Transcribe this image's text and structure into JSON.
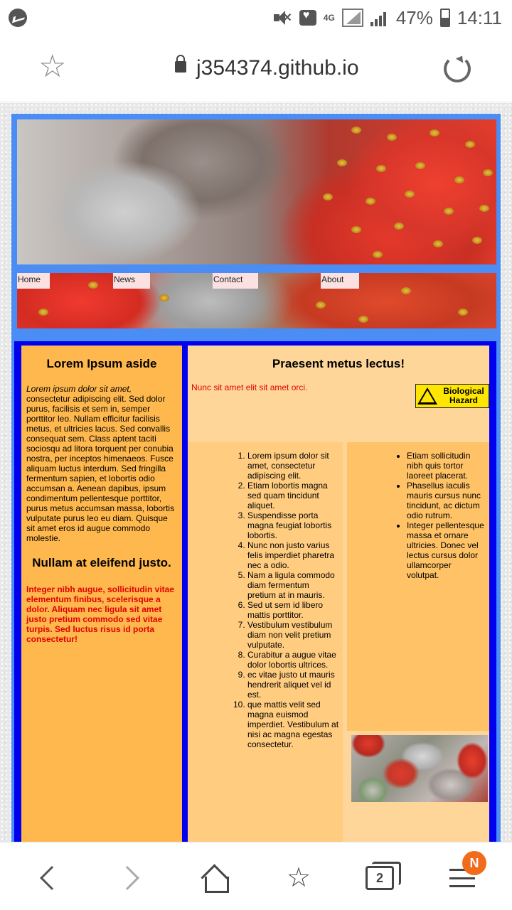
{
  "status_bar": {
    "network": "4G",
    "battery": "47%",
    "time": "14:11"
  },
  "browser": {
    "url": "j354374.github.io",
    "tab_count": "2",
    "notification_badge": "N"
  },
  "nav": {
    "items": [
      "Home",
      "News",
      "Contact",
      "About"
    ]
  },
  "aside": {
    "heading": "Lorem Ipsum aside",
    "intro_italic": "Lorem ipsum dolor sit amet,",
    "body": " consectetur adipiscing elit. Sed dolor purus, facilisis et sem in, semper porttitor leo. Nullam efficitur facilisis metus, et ultricies lacus. Sed convallis consequat sem. Class aptent taciti sociosqu ad litora torquent per conubia nostra, per inceptos himenaeos. Fusce aliquam luctus interdum. Sed fringilla fermentum sapien, et lobortis odio accumsan a. Aenean dapibus, ipsum condimentum pellentesque porttitor, purus metus accumsan massa, lobortis vulputate purus leo eu diam. Quisque sit amet eros id augue commodo molestie.",
    "heading2": "Nullam at eleifend justo.",
    "red_text": "Integer nibh augue, sollicitudin vitae elementum finibus, scelerisque a dolor. Aliquam nec ligula sit amet justo pretium commodo sed vitae turpis. Sed luctus risus id porta consectetur!"
  },
  "main": {
    "heading": "Praesent metus lectus!",
    "note": "Nunc sit amet elit sit amet orci.",
    "biohazard_label_1": "Biological",
    "biohazard_label_2": "Hazard",
    "ordered_list": [
      "Lorem ipsum dolor sit amet, consectetur adipiscing elit.",
      "Etiam lobortis magna sed quam tincidunt aliquet.",
      "Suspendisse porta magna feugiat lobortis lobortis.",
      "Nunc non justo varius felis imperdiet pharetra nec a odio.",
      "Nam a ligula commodo diam fermentum pretium at in mauris.",
      "Sed ut sem id libero mattis porttitor.",
      "Vestibulum vestibulum diam non velit pretium vulputate.",
      "Curabitur a augue vitae dolor lobortis ultrices.",
      "ec vitae justo ut mauris hendrerit aliquet vel id est.",
      "que mattis velit sed magna euismod imperdiet. Vestibulum at nisi ac magna egestas consectetur."
    ],
    "bullet_list": [
      "Etiam sollicitudin nibh quis tortor laoreet placerat.",
      "Phasellus iaculis mauris cursus nunc tincidunt, ac dictum odio rutrum.",
      "Integer pellentesque massa et ornare ultricies. Donec vel lectus cursus dolor ullamcorper volutpat."
    ]
  }
}
